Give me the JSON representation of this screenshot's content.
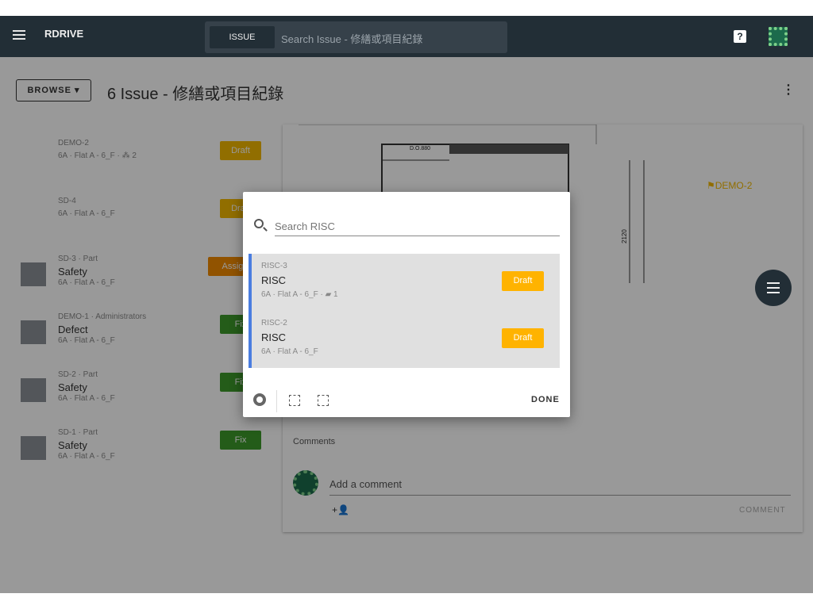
{
  "header": {
    "logo": "RDRIVE",
    "search_scope": "ISSUE",
    "search_placeholder": "Search Issue - 修繕或項目紀錄"
  },
  "title_bar": {
    "browse_label": "BROWSE ▾",
    "page_title": "6 Issue - 修繕或項目紀錄"
  },
  "issues": [
    {
      "sub": "DEMO-2",
      "name": "",
      "loc": "6A · Flat A - 6_F · ⁂ 2",
      "status": "Draft",
      "status_kind": "draft"
    },
    {
      "sub": "SD-4",
      "name": "",
      "loc": "6A · Flat A - 6_F",
      "status": "Draft",
      "status_kind": "draft"
    },
    {
      "sub": "SD-3 · Part",
      "name": "Safety",
      "loc": "6A · Flat A - 6_F",
      "status": "Assign",
      "status_kind": "assign"
    },
    {
      "sub": "DEMO-1 · Administrators",
      "name": "Defect",
      "loc": "6A · Flat A - 6_F",
      "status": "Fix",
      "status_kind": "fix"
    },
    {
      "sub": "SD-2 · Part",
      "name": "Safety",
      "loc": "6A · Flat A - 6_F",
      "status": "Fix",
      "status_kind": "fix"
    },
    {
      "sub": "SD-1 · Part",
      "name": "Safety",
      "loc": "6A · Flat A - 6_F",
      "status": "Fix",
      "status_kind": "fix"
    }
  ],
  "drawing": {
    "labels": [
      "D.O.880",
      "2120"
    ],
    "flag_label": "DEMO-2"
  },
  "comments": {
    "heading": "Comments",
    "placeholder": "Add a comment",
    "button": "COMMENT"
  },
  "dialog": {
    "search_placeholder": "Search RISC",
    "items": [
      {
        "sub": "RISC-3",
        "name": "RISC",
        "loc": "6A · Flat A - 6_F · ▰ 1",
        "status": "Draft"
      },
      {
        "sub": "RISC-2",
        "name": "RISC",
        "loc": "6A · Flat A - 6_F",
        "status": "Draft"
      }
    ],
    "done_label": "DONE"
  },
  "colors": {
    "topbar": "#222e36",
    "draft": "#f2b800",
    "assign": "#f28a00",
    "fix": "#3d9a2b",
    "accent": "#4a7de0"
  }
}
